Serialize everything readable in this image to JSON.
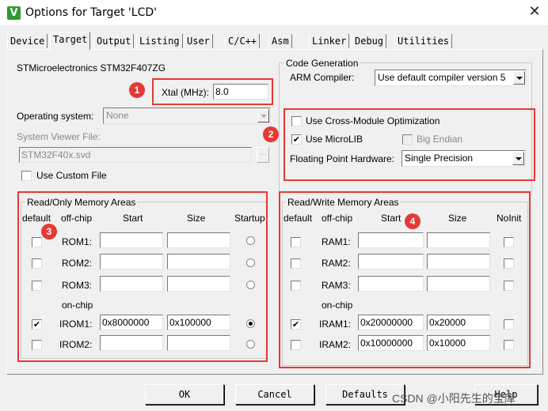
{
  "window": {
    "title": "Options for Target 'LCD'",
    "icon": "keil-uvision-icon",
    "close": "✕"
  },
  "tabs": [
    "Device",
    "Target",
    "Output",
    "Listing",
    "User",
    "C/C++",
    "Asm",
    "Linker",
    "Debug",
    "Utilities"
  ],
  "active_tab": "Target",
  "target": {
    "device_name": "STMicroelectronics STM32F407ZG",
    "xtal_label": "Xtal (MHz):",
    "xtal_value": "8.0",
    "os_label": "Operating system:",
    "os_value": "None",
    "sysviewer_label": "System Viewer File:",
    "sysviewer_value": "STM32F40x.svd",
    "sysviewer_browse": "...",
    "use_custom_file": "Use Custom File"
  },
  "codegen": {
    "title": "Code Generation",
    "arm_compiler_label": "ARM Compiler:",
    "arm_compiler_value": "Use default compiler version 5",
    "cross_module": "Use Cross-Module Optimization",
    "microlib": "Use MicroLIB",
    "big_endian": "Big Endian",
    "fph_label": "Floating Point Hardware:",
    "fph_value": "Single Precision"
  },
  "rom": {
    "title": "Read/Only Memory Areas",
    "headers": {
      "default": "default",
      "offchip": "off-chip",
      "start": "Start",
      "size": "Size",
      "startup": "Startup"
    },
    "onchip": "on-chip",
    "rows": [
      {
        "name": "ROM1:",
        "start": "",
        "size": "",
        "default": false,
        "startup": false
      },
      {
        "name": "ROM2:",
        "start": "",
        "size": "",
        "default": false,
        "startup": false
      },
      {
        "name": "ROM3:",
        "start": "",
        "size": "",
        "default": false,
        "startup": false
      },
      {
        "name": "IROM1:",
        "start": "0x8000000",
        "size": "0x100000",
        "default": true,
        "startup": true
      },
      {
        "name": "IROM2:",
        "start": "",
        "size": "",
        "default": false,
        "startup": false
      }
    ]
  },
  "ram": {
    "title": "Read/Write Memory Areas",
    "headers": {
      "default": "default",
      "offchip": "off-chip",
      "start": "Start",
      "size": "Size",
      "noinit": "NoInit"
    },
    "onchip": "on-chip",
    "rows": [
      {
        "name": "RAM1:",
        "start": "",
        "size": "",
        "default": false,
        "noinit": false
      },
      {
        "name": "RAM2:",
        "start": "",
        "size": "",
        "default": false,
        "noinit": false
      },
      {
        "name": "RAM3:",
        "start": "",
        "size": "",
        "default": false,
        "noinit": false
      },
      {
        "name": "IRAM1:",
        "start": "0x20000000",
        "size": "0x20000",
        "default": true,
        "noinit": false
      },
      {
        "name": "IRAM2:",
        "start": "0x10000000",
        "size": "0x10000",
        "default": false,
        "noinit": false
      }
    ]
  },
  "annotations": [
    "1",
    "2",
    "3",
    "4"
  ],
  "annotation_color": "#e53935",
  "buttons": {
    "ok": "OK",
    "cancel": "Cancel",
    "defaults": "Defaults",
    "help": "Help"
  },
  "watermark": "CSDN @小阳先生的宝库"
}
